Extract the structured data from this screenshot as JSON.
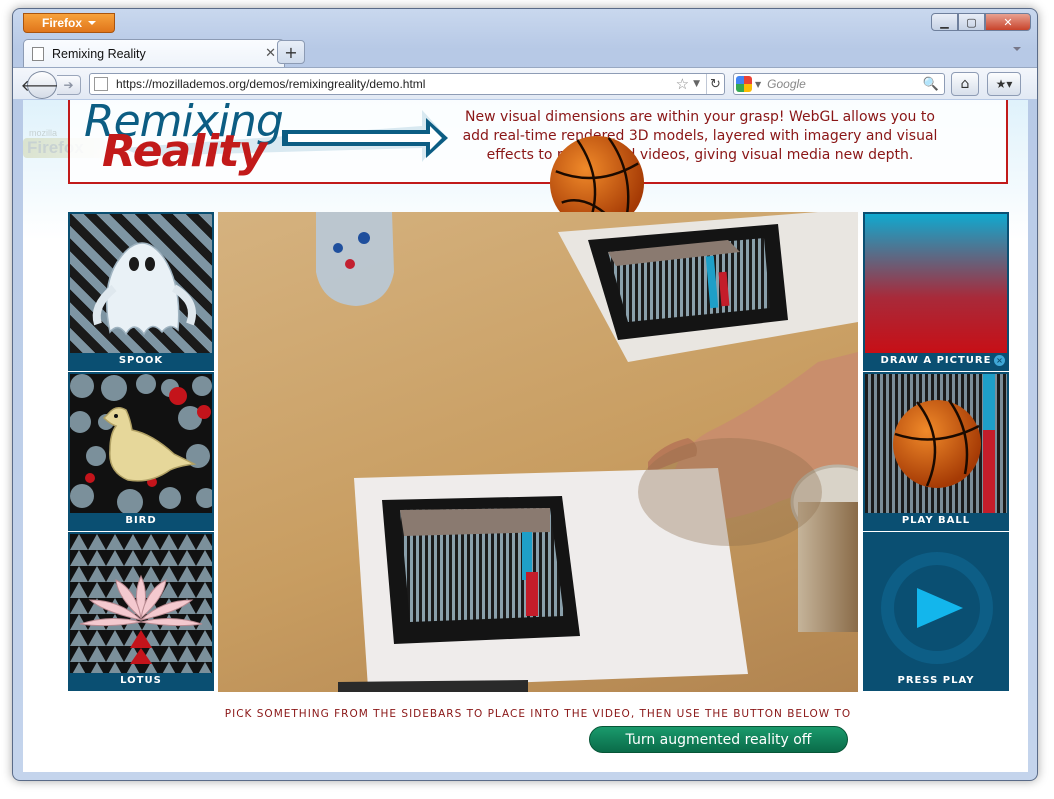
{
  "browser": {
    "app_menu_label": "Firefox",
    "tab": {
      "title": "Remixing Reality"
    },
    "url": "https://mozillademos.org/demos/remixingreality/demo.html",
    "search": {
      "engine_icon": "google-icon",
      "placeholder": "Google"
    },
    "window_controls": [
      "minimize",
      "maximize",
      "close"
    ]
  },
  "page": {
    "watermark": {
      "small": "mozilla",
      "big": "Firefox"
    },
    "logo": {
      "word1": "Remixing",
      "word2": "Reality"
    },
    "tagline": "New visual dimensions are within your grasp! WebGL allows you to add real-time rendered 3D models, layered with imagery and visual effects to photos and videos, giving visual media new depth.",
    "left_sidebar": [
      {
        "label": "SPOOK",
        "icon": "ghost-icon"
      },
      {
        "label": "BIRD",
        "icon": "bird-icon"
      },
      {
        "label": "LOTUS",
        "icon": "lotus-icon"
      }
    ],
    "right_sidebar": [
      {
        "label": "DRAW A PICTURE",
        "icon": "gradient-icon"
      },
      {
        "label": "PLAY BALL",
        "icon": "basketball-icon"
      },
      {
        "label": "PRESS PLAY",
        "icon": "play-icon"
      }
    ],
    "instructions": "PICK SOMETHING FROM THE SIDEBARS TO PLACE INTO THE VIDEO, THEN USE THE BUTTON BELOW TO",
    "ar_toggle_label": "Turn augmented reality off"
  },
  "colors": {
    "brand_blue": "#0a4f72",
    "brand_red": "#c11a1a",
    "toggle_green": "#0a6b49",
    "play_blue": "#13b6ec"
  }
}
